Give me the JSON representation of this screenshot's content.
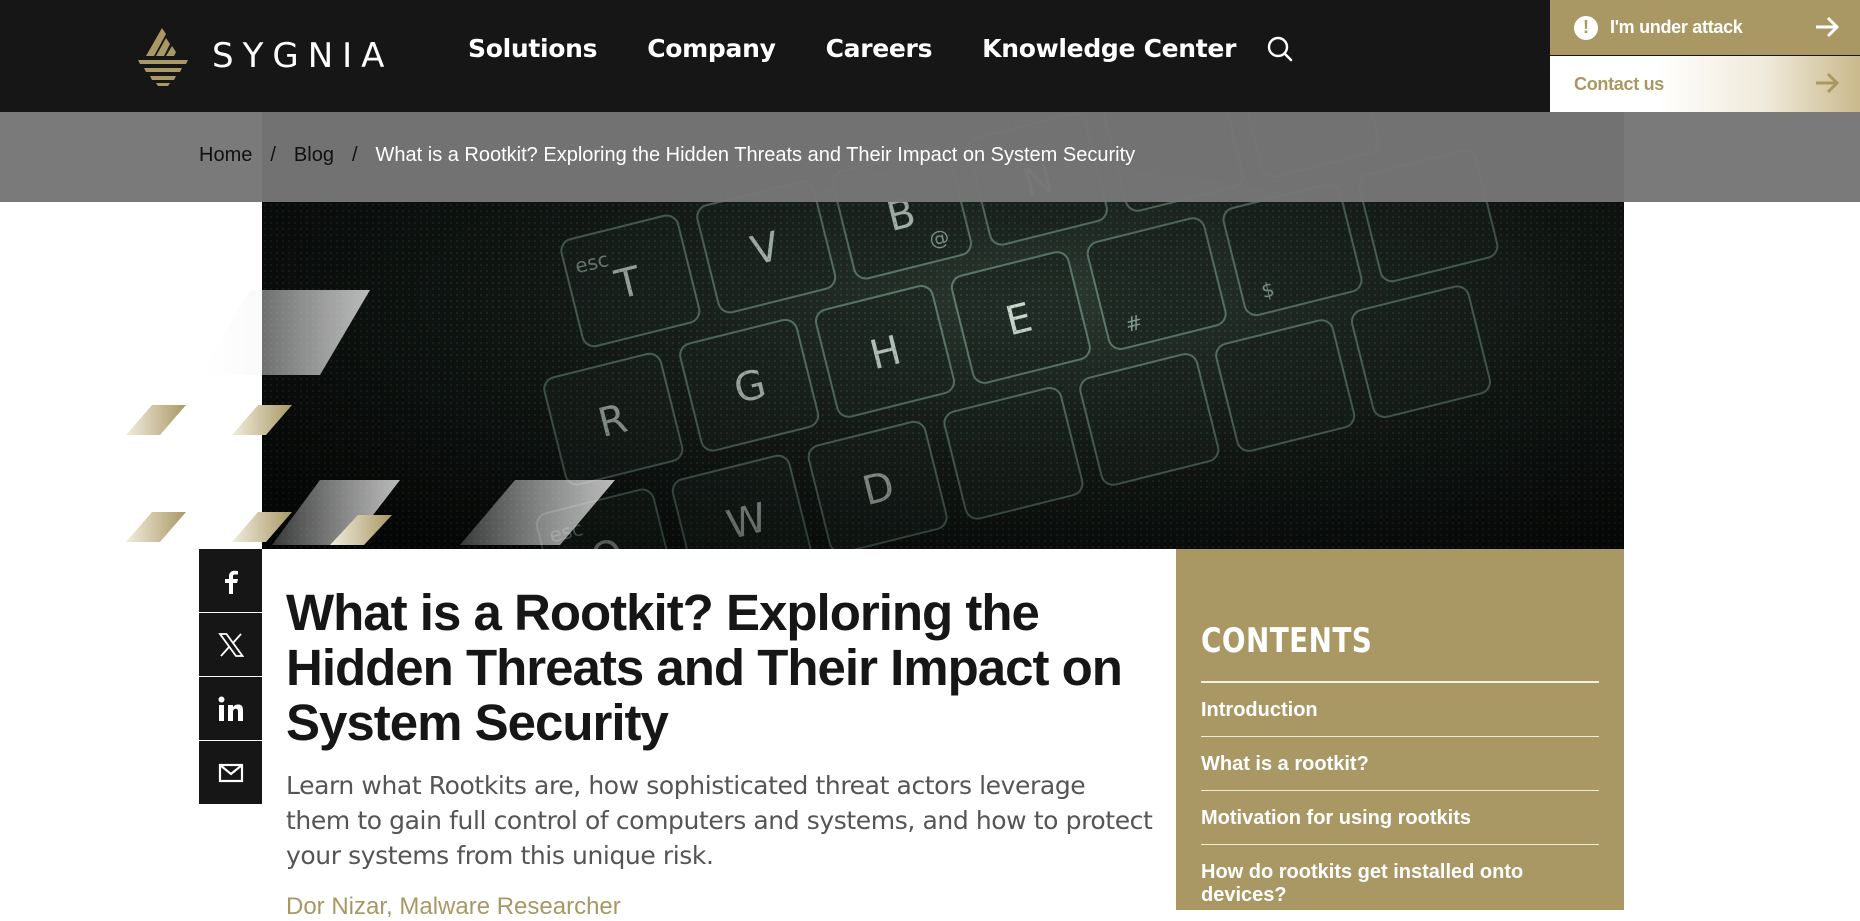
{
  "header": {
    "brand": "SYGNIA",
    "nav": [
      "Solutions",
      "Company",
      "Careers",
      "Knowledge Center"
    ],
    "cta_attack": "I'm under attack",
    "cta_contact": "Contact us"
  },
  "breadcrumb": {
    "items": [
      "Home",
      "Blog"
    ],
    "current": "What is a Rootkit? Exploring the Hidden Threats and Their Impact on System Security"
  },
  "hero": {
    "keys": [
      "T",
      "V",
      "B",
      "N",
      "R",
      "G",
      "H",
      "E",
      "Q",
      "W",
      "D",
      "esc",
      "esc",
      "@",
      "#",
      "$"
    ]
  },
  "share": [
    "facebook",
    "x",
    "linkedin",
    "email"
  ],
  "article": {
    "title": "What is a Rootkit? Exploring the Hidden Threats and Their Impact on System Security",
    "lead": "Learn what Rootkits are, how sophisticated threat actors leverage them to gain full control of computers and systems, and how to protect your systems from this unique risk.",
    "author": "Dor Nizar, Malware Researcher"
  },
  "contents": {
    "heading": "CONTENTS",
    "items": [
      "Introduction",
      "What is a rootkit?",
      "Motivation for using rootkits",
      "How do rootkits get installed onto devices?"
    ]
  },
  "colors": {
    "gold": "#a99864",
    "dark": "#161616",
    "breadcrumb_bg": "#767676"
  }
}
